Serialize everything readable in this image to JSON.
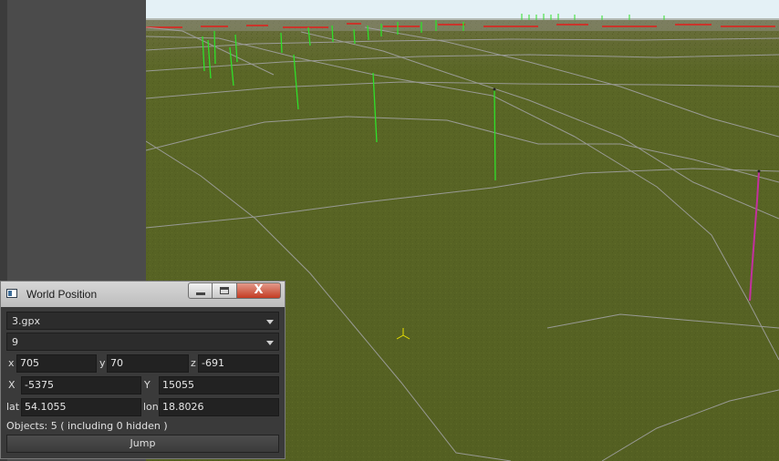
{
  "window": {
    "title": "World Position",
    "close_glyph": "X"
  },
  "file_select": {
    "value": "3.gpx"
  },
  "track_select": {
    "value": "9"
  },
  "local_coords": {
    "x_label": "x",
    "x_value": "705",
    "y_label": "y",
    "y_value": "70",
    "z_label": "z",
    "z_value": "-691"
  },
  "world_coords": {
    "X_label": "X",
    "X_value": "-5375",
    "Y_label": "Y",
    "Y_value": "15055"
  },
  "geo_coords": {
    "lat_label": "lat",
    "lat_value": "54.1055",
    "lon_label": "lon",
    "lon_value": "18.8026"
  },
  "status": {
    "objects_text": "Objects: 5 ( including 0 hidden )"
  },
  "actions": {
    "jump_label": "Jump"
  },
  "icons": {
    "app": "window-app-icon",
    "minimize": "minimize-icon",
    "maximize": "maximize-icon",
    "close": "close-icon",
    "dropdown": "chevron-down-icon",
    "marker": "position-marker-icon"
  },
  "colors": {
    "terrain": "#566221",
    "sky": "#e4f1f6",
    "track_marker": "#2fe02a",
    "selected_marker": "#c3309e",
    "panel_bg": "#3a3a3a",
    "close_button": "#c43b23"
  }
}
